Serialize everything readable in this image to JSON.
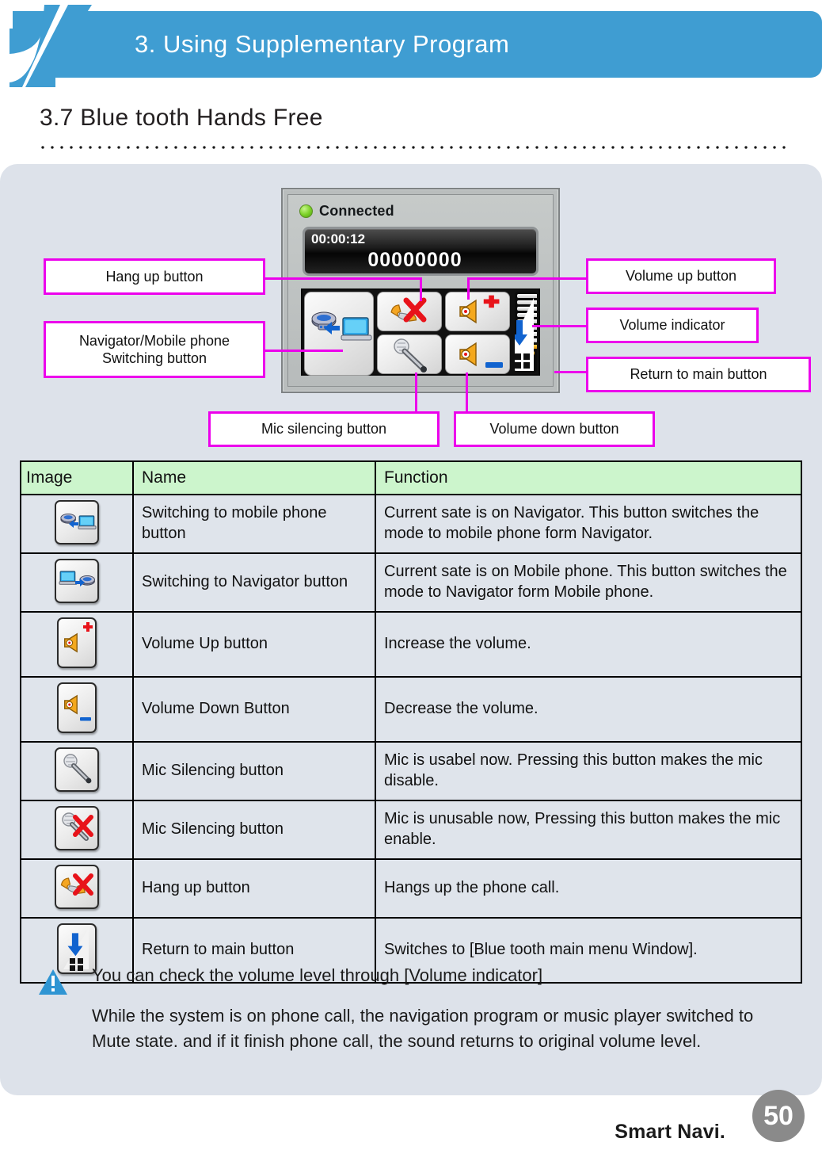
{
  "header": {
    "chapter_title": "3. Using Supplementary Program",
    "logo_icon": "brand-swoosh-logo",
    "accent_color": "#3f9dd2"
  },
  "section": {
    "title": "3.7 Blue tooth Hands Free"
  },
  "device": {
    "status_icon": "green-led-icon",
    "status_label": "Connected",
    "call_timer": "00:00:12",
    "phone_number": "00000000",
    "buttons": [
      {
        "name": "navigator-mobile-switch-button",
        "icon": "navigator-to-mobile-icon"
      },
      {
        "name": "hang-up-button",
        "icon": "phone-with-red-x-icon"
      },
      {
        "name": "volume-up-button",
        "icon": "speaker-plus-icon"
      },
      {
        "name": "mic-silencing-button",
        "icon": "microphone-icon"
      },
      {
        "name": "volume-down-button",
        "icon": "speaker-minus-icon"
      },
      {
        "name": "return-to-main-button",
        "icon": "arrow-down-right-grid-icon"
      }
    ],
    "volume_indicator": {
      "name": "volume-indicator",
      "total_steps": 12,
      "filled_steps": 4
    }
  },
  "callouts": {
    "hang_up": "Hang up button",
    "switch": "Navigator/Mobile phone\nSwitching button",
    "volume_up": "Volume up button",
    "volume_indicator": "Volume indicator",
    "return_main": "Return to main button",
    "mic_silencing": "Mic silencing button",
    "volume_down": "Volume down button",
    "line_color": "#ec00ec"
  },
  "table": {
    "header_bg": "#ccf5cc",
    "columns": [
      "Image",
      "Name",
      "Function"
    ],
    "rows": [
      {
        "icon": "navigator-to-mobile-icon",
        "name": "Switching to mobile phone button",
        "function": "Current sate is on Navigator. This button switches the mode to mobile phone form Navigator."
      },
      {
        "icon": "mobile-to-navigator-icon",
        "name": "Switching to Navigator button",
        "function": "Current sate is on Mobile phone. This button switches the mode to Navigator form Mobile phone."
      },
      {
        "icon": "speaker-plus-icon",
        "name": "Volume Up button",
        "function": "Increase the volume."
      },
      {
        "icon": "speaker-minus-icon",
        "name": "Volume Down Button",
        "function": "Decrease the volume."
      },
      {
        "icon": "microphone-icon",
        "name": "Mic Silencing button",
        "function": "Mic is usabel now. Pressing this button makes the mic disable."
      },
      {
        "icon": "microphone-red-x-icon",
        "name": "Mic Silencing button",
        "function": "Mic is unusable now, Pressing this button makes the mic enable."
      },
      {
        "icon": "phone-with-red-x-icon",
        "name": "Hang up button",
        "function": "Hangs up the phone call."
      },
      {
        "icon": "arrow-down-right-grid-icon",
        "name": "Return to main button",
        "function": "Switches to [Blue tooth main menu Window]."
      }
    ]
  },
  "note": {
    "icon": "warning-triangle-icon",
    "line1": "You can check the volume level through [Volume indicator]",
    "line2": "While the system is on phone call, the navigation program or music player switched to Mute state. and if it finish phone call, the sound returns to original volume level."
  },
  "footer": {
    "brand": "Smart Navi.",
    "page_number": "50",
    "page_badge_color": "#8a8a8a"
  }
}
